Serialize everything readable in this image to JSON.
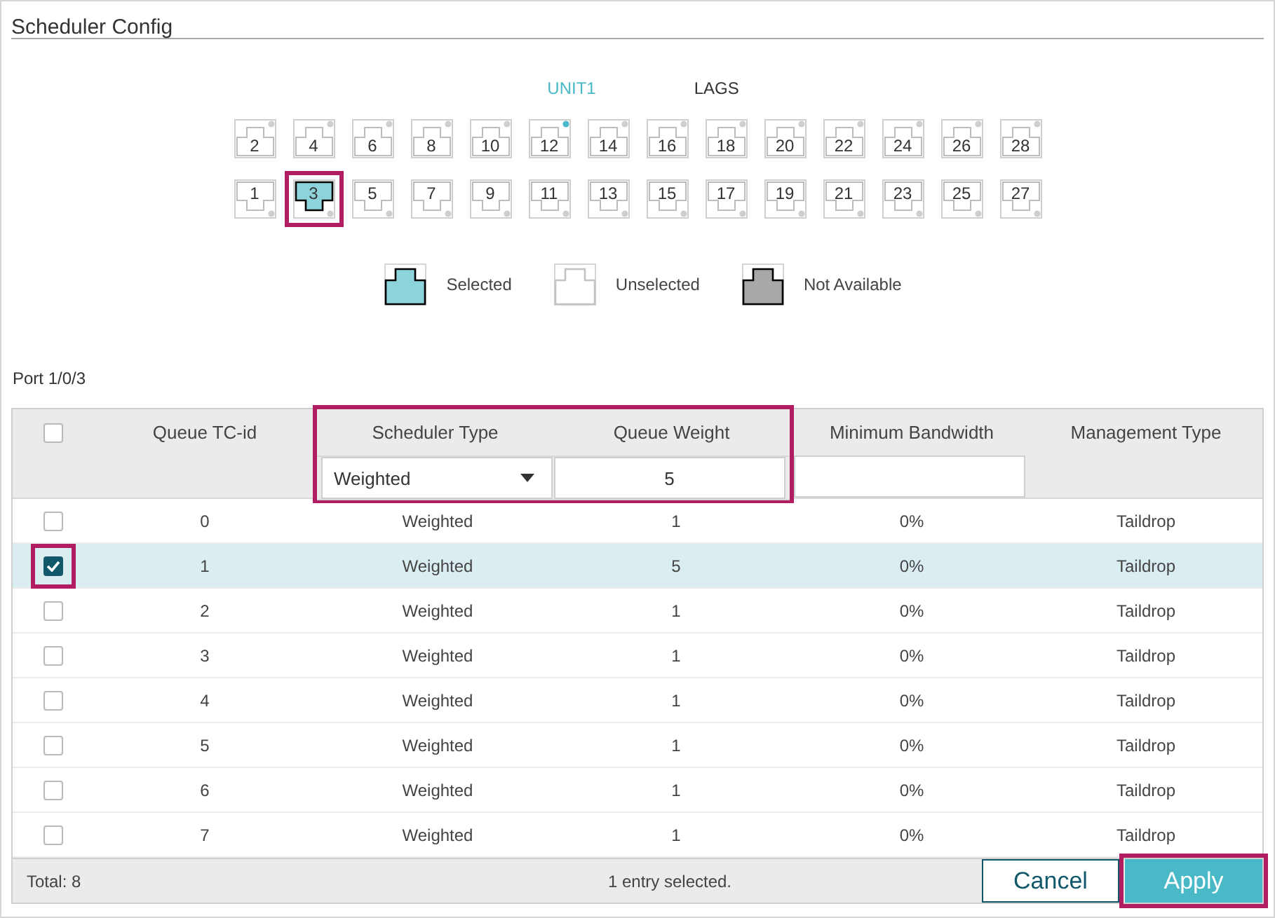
{
  "title": "Scheduler Config",
  "unit_tabs": [
    {
      "label": "UNIT1",
      "selected": true
    },
    {
      "label": "LAGS",
      "selected": false
    }
  ],
  "port_rows": [
    {
      "kind": "upper",
      "ports": [
        {
          "label": "2",
          "selected": false,
          "link_up": false,
          "highlighted": false
        },
        {
          "label": "4",
          "selected": false,
          "link_up": false,
          "highlighted": false
        },
        {
          "label": "6",
          "selected": false,
          "link_up": false,
          "highlighted": false
        },
        {
          "label": "8",
          "selected": false,
          "link_up": false,
          "highlighted": false
        },
        {
          "label": "10",
          "selected": false,
          "link_up": false,
          "highlighted": false
        },
        {
          "label": "12",
          "selected": false,
          "link_up": true,
          "highlighted": false
        },
        {
          "label": "14",
          "selected": false,
          "link_up": false,
          "highlighted": false
        },
        {
          "label": "16",
          "selected": false,
          "link_up": false,
          "highlighted": false
        },
        {
          "label": "18",
          "selected": false,
          "link_up": false,
          "highlighted": false
        },
        {
          "label": "20",
          "selected": false,
          "link_up": false,
          "highlighted": false
        },
        {
          "label": "22",
          "selected": false,
          "link_up": false,
          "highlighted": false
        },
        {
          "label": "24",
          "selected": false,
          "link_up": false,
          "highlighted": false
        },
        {
          "label": "26",
          "selected": false,
          "link_up": false,
          "highlighted": false
        },
        {
          "label": "28",
          "selected": false,
          "link_up": false,
          "highlighted": false
        }
      ]
    },
    {
      "kind": "lower",
      "ports": [
        {
          "label": "1",
          "selected": false,
          "link_up": false,
          "highlighted": false
        },
        {
          "label": "3",
          "selected": true,
          "link_up": false,
          "highlighted": true
        },
        {
          "label": "5",
          "selected": false,
          "link_up": false,
          "highlighted": false
        },
        {
          "label": "7",
          "selected": false,
          "link_up": false,
          "highlighted": false
        },
        {
          "label": "9",
          "selected": false,
          "link_up": false,
          "highlighted": false
        },
        {
          "label": "11",
          "selected": false,
          "link_up": false,
          "highlighted": false
        },
        {
          "label": "13",
          "selected": false,
          "link_up": false,
          "highlighted": false
        },
        {
          "label": "15",
          "selected": false,
          "link_up": false,
          "highlighted": false
        },
        {
          "label": "17",
          "selected": false,
          "link_up": false,
          "highlighted": false
        },
        {
          "label": "19",
          "selected": false,
          "link_up": false,
          "highlighted": false
        },
        {
          "label": "21",
          "selected": false,
          "link_up": false,
          "highlighted": false
        },
        {
          "label": "23",
          "selected": false,
          "link_up": false,
          "highlighted": false
        },
        {
          "label": "25",
          "selected": false,
          "link_up": false,
          "highlighted": false
        },
        {
          "label": "27",
          "selected": false,
          "link_up": false,
          "highlighted": false
        }
      ]
    }
  ],
  "legend": [
    {
      "kind": "selected",
      "label": "Selected"
    },
    {
      "kind": "unselected",
      "label": "Unselected"
    },
    {
      "kind": "unavailable",
      "label": "Not Available"
    }
  ],
  "port_caption": "Port 1/0/3",
  "table": {
    "select_all": {
      "checked": false
    },
    "columns": [
      "Queue TC-id",
      "Scheduler Type",
      "Queue Weight",
      "Minimum Bandwidth",
      "Management Type"
    ],
    "edit_row": {
      "scheduler_type": "Weighted",
      "queue_weight": "5",
      "highlighted": true
    },
    "rows": [
      {
        "tc_id": "0",
        "scheduler_type": "Weighted",
        "queue_weight": "1",
        "min_bandwidth": "0%",
        "management_type": "Taildrop",
        "selected": false,
        "highlighted": false
      },
      {
        "tc_id": "1",
        "scheduler_type": "Weighted",
        "queue_weight": "5",
        "min_bandwidth": "0%",
        "management_type": "Taildrop",
        "selected": true,
        "highlighted": true
      },
      {
        "tc_id": "2",
        "scheduler_type": "Weighted",
        "queue_weight": "1",
        "min_bandwidth": "0%",
        "management_type": "Taildrop",
        "selected": false,
        "highlighted": false
      },
      {
        "tc_id": "3",
        "scheduler_type": "Weighted",
        "queue_weight": "1",
        "min_bandwidth": "0%",
        "management_type": "Taildrop",
        "selected": false,
        "highlighted": false
      },
      {
        "tc_id": "4",
        "scheduler_type": "Weighted",
        "queue_weight": "1",
        "min_bandwidth": "0%",
        "management_type": "Taildrop",
        "selected": false,
        "highlighted": false
      },
      {
        "tc_id": "5",
        "scheduler_type": "Weighted",
        "queue_weight": "1",
        "min_bandwidth": "0%",
        "management_type": "Taildrop",
        "selected": false,
        "highlighted": false
      },
      {
        "tc_id": "6",
        "scheduler_type": "Weighted",
        "queue_weight": "1",
        "min_bandwidth": "0%",
        "management_type": "Taildrop",
        "selected": false,
        "highlighted": false
      },
      {
        "tc_id": "7",
        "scheduler_type": "Weighted",
        "queue_weight": "1",
        "min_bandwidth": "0%",
        "management_type": "Taildrop",
        "selected": false,
        "highlighted": false
      }
    ],
    "total": "Total: 8",
    "selection_info": "1 entry selected."
  },
  "buttons": [
    {
      "kind": "secondary",
      "label": "Cancel",
      "highlighted": false
    },
    {
      "kind": "primary",
      "label": "Apply",
      "highlighted": true
    }
  ]
}
